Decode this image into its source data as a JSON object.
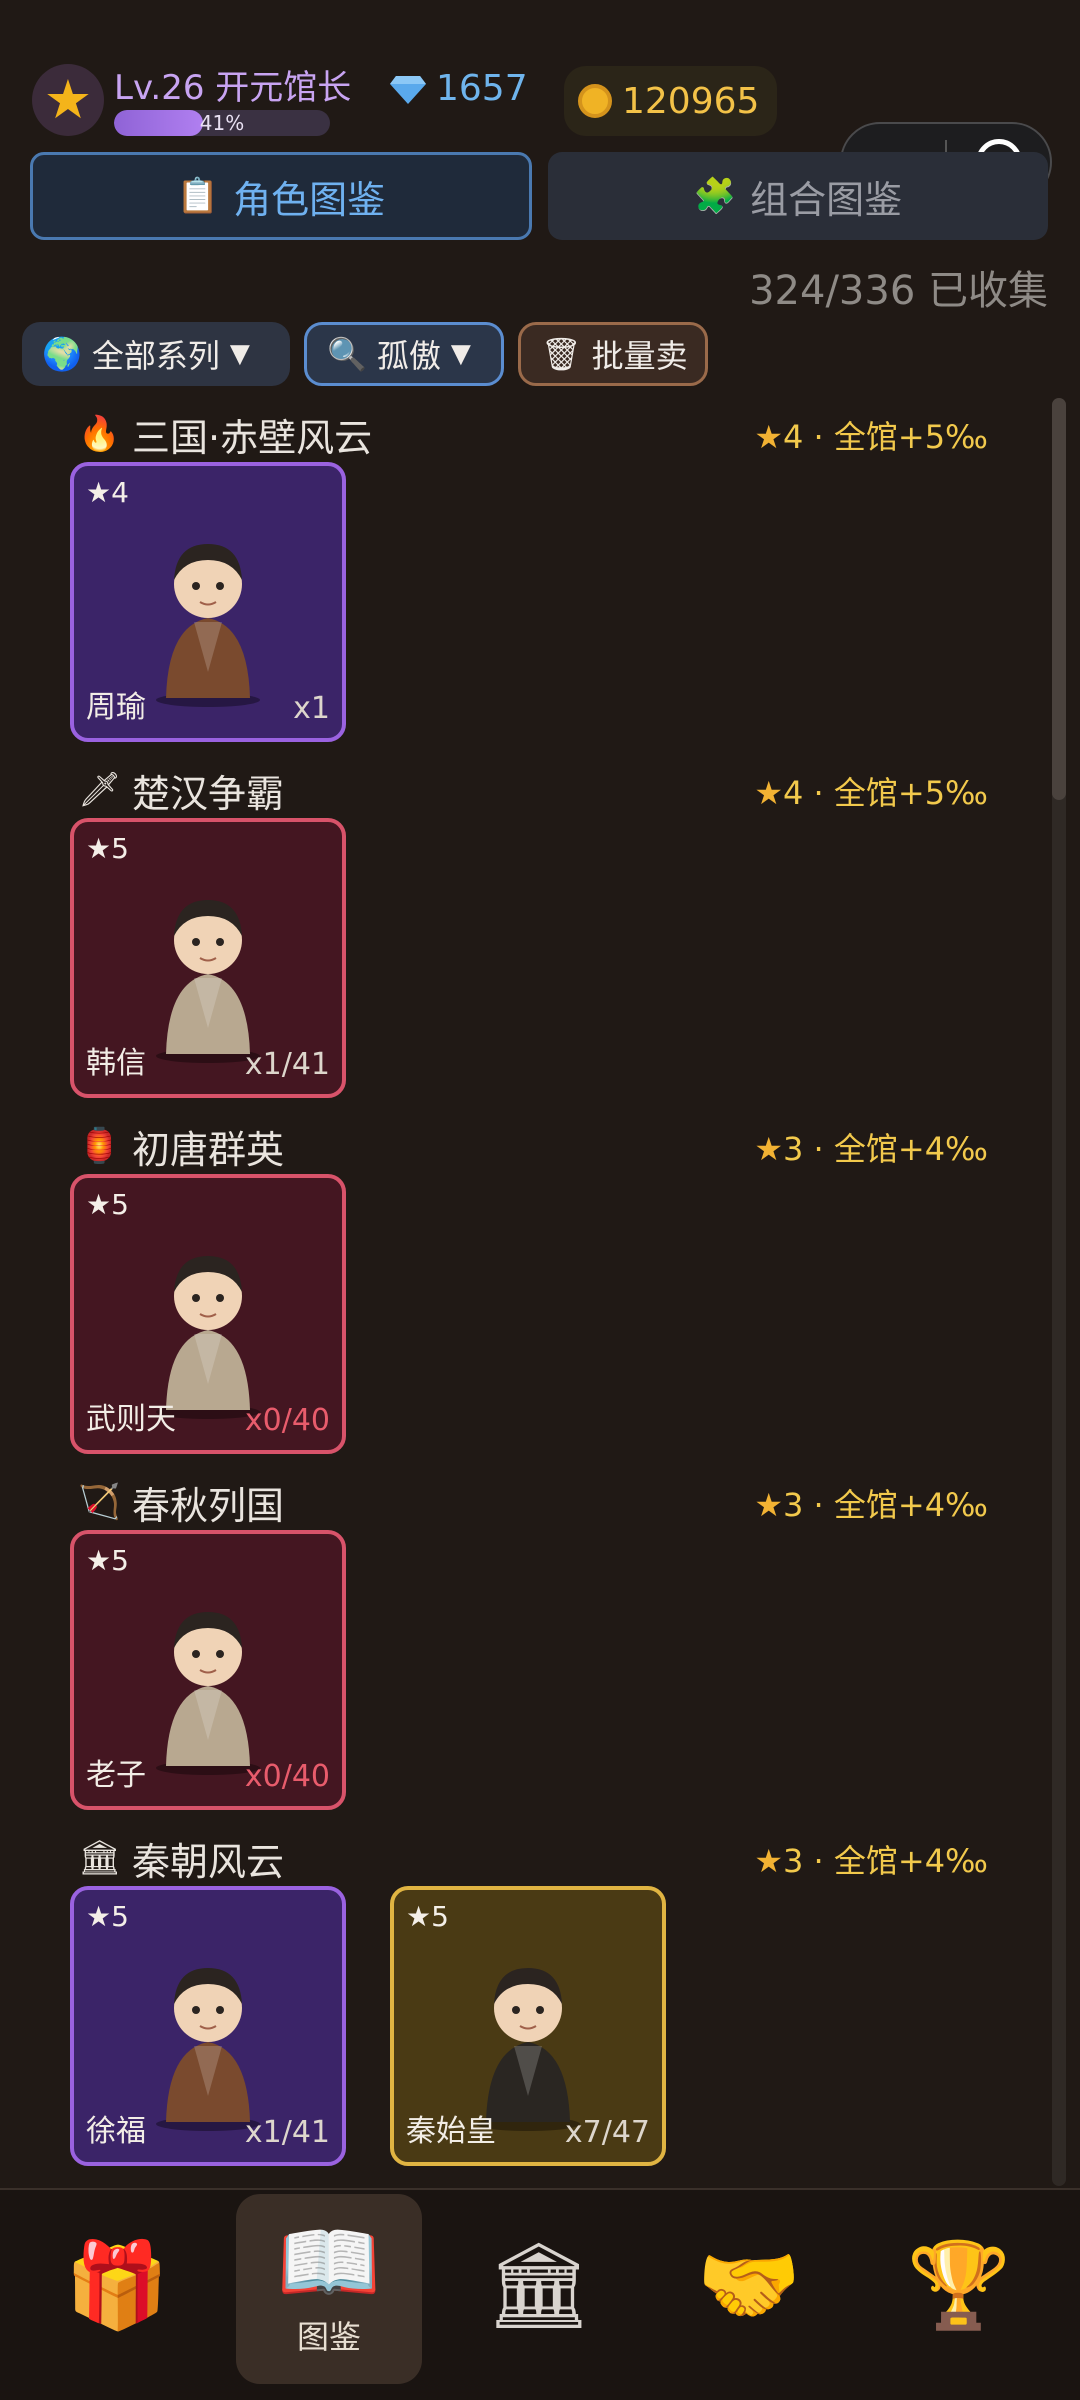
{
  "header": {
    "avatar_icon": "star-icon",
    "level_title": "Lv.26 开元馆长",
    "xp_percent": 41,
    "xp_label": "41%",
    "gems": "1657",
    "coins": "120965"
  },
  "capsule": {
    "more_icon": "more-dots-icon",
    "target_icon": "record-target-icon"
  },
  "tabs": {
    "character": {
      "label": "角色图鉴",
      "icon": "clipboard-icon"
    },
    "combo": {
      "label": "组合图鉴",
      "icon": "puzzle-icon"
    }
  },
  "collection_progress": "324/336 已收集",
  "filters": {
    "series": "全部系列",
    "trait": "孤傲",
    "bulk_sell": "批量卖"
  },
  "sections": [
    {
      "icon": "🔥",
      "title": "三国·赤壁风云",
      "bonus": "4 · 全馆+5‰",
      "cards": [
        {
          "rarity": "★4",
          "name": "周瑜",
          "count": "x1",
          "color": "purple"
        }
      ]
    },
    {
      "icon": "🗡",
      "title": "楚汉争霸",
      "bonus": "4 · 全馆+5‰",
      "cards": [
        {
          "rarity": "★5",
          "name": "韩信",
          "count": "x1/41",
          "color": "red"
        }
      ]
    },
    {
      "icon": "🏮",
      "title": "初唐群英",
      "bonus": "3 · 全馆+4‰",
      "cards": [
        {
          "rarity": "★5",
          "name": "武则天",
          "count": "x0/40",
          "color": "red"
        }
      ]
    },
    {
      "icon": "🏹",
      "title": "春秋列国",
      "bonus": "3 · 全馆+4‰",
      "cards": [
        {
          "rarity": "★5",
          "name": "老子",
          "count": "x0/40",
          "color": "red"
        }
      ]
    },
    {
      "icon": "🏛",
      "title": "秦朝风云",
      "bonus": "3 · 全馆+4‰",
      "cards": [
        {
          "rarity": "★5",
          "name": "徐福",
          "count": "x1/41",
          "color": "purple"
        },
        {
          "rarity": "★5",
          "name": "秦始皇",
          "count": "x7/47",
          "color": "gold"
        }
      ]
    }
  ],
  "nav": [
    {
      "icon": "🎁",
      "label": "",
      "name": "gift"
    },
    {
      "icon": "📖",
      "label": "图鉴",
      "name": "codex",
      "active": true
    },
    {
      "icon": "🏛",
      "label": "",
      "name": "museum"
    },
    {
      "icon": "🤝",
      "label": "",
      "name": "trade"
    },
    {
      "icon": "🏆",
      "label": "",
      "name": "trophy"
    }
  ]
}
